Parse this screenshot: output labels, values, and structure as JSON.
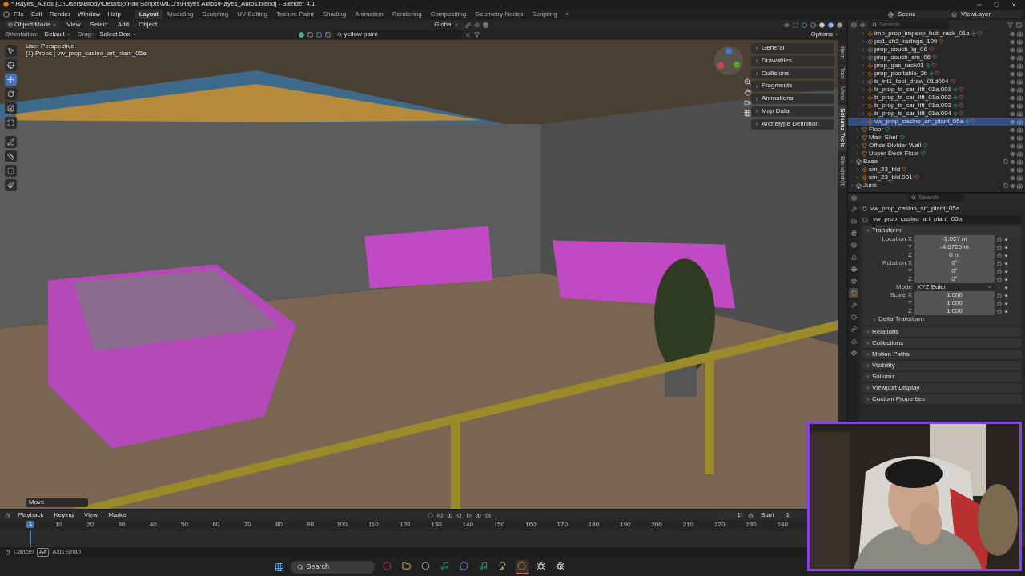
{
  "window": {
    "title": "* Hayes_Autos [C:\\Users\\Brody\\Desktop\\Fax Scripts\\MLO's\\Hayes Autos\\Hayes_Autos.blend] - Blender 4.1"
  },
  "menu": [
    "File",
    "Edit",
    "Render",
    "Window",
    "Help"
  ],
  "workspaces": [
    {
      "label": "Layout",
      "selected": true
    },
    {
      "label": "Modeling",
      "selected": false
    },
    {
      "label": "Sculpting",
      "selected": false
    },
    {
      "label": "UV Editing",
      "selected": false
    },
    {
      "label": "Texture Paint",
      "selected": false
    },
    {
      "label": "Shading",
      "selected": false
    },
    {
      "label": "Animation",
      "selected": false
    },
    {
      "label": "Rendering",
      "selected": false
    },
    {
      "label": "Compositing",
      "selected": false
    },
    {
      "label": "Geometry Nodes",
      "selected": false
    },
    {
      "label": "Scripting",
      "selected": false
    }
  ],
  "add_workspace": "+",
  "scene": "Scene",
  "view_layer": "ViewLayer",
  "viewport": {
    "mode": "Object Mode",
    "menus": [
      "View",
      "Select",
      "Add",
      "Object"
    ],
    "orientation_label": "Orientation:",
    "orientation": "Default",
    "drag_label": "Drag:",
    "drag": "Select Box",
    "transform": "Global",
    "search": "yellow paint",
    "options": "Options",
    "info": [
      "User Perspective",
      "(1) Props | vw_prop_casino_art_plant_05a"
    ],
    "last_operator": "Move",
    "tools": [
      {
        "kind": "select",
        "selected": false
      },
      {
        "kind": "cursor",
        "selected": false
      },
      {
        "kind": "move",
        "selected": true
      },
      {
        "kind": "rotate",
        "selected": false
      },
      {
        "kind": "scale",
        "selected": false
      },
      {
        "kind": "transform",
        "selected": false
      },
      {
        "kind": "annotate",
        "selected": false
      },
      {
        "kind": "measure",
        "selected": false
      },
      {
        "kind": "add",
        "selected": false
      },
      {
        "kind": "paint",
        "selected": false
      }
    ]
  },
  "n_panel": {
    "sections": [
      "General",
      "Drawables",
      "Collisions",
      "Fragments",
      "Animations",
      "Map Data",
      "Archetype Definition"
    ],
    "tabs": [
      {
        "label": "Item",
        "selected": false
      },
      {
        "label": "Tool",
        "selected": false
      },
      {
        "label": "View",
        "selected": false
      },
      {
        "label": "Sollumz Tools",
        "selected": true
      },
      {
        "label": "BlenderKit",
        "selected": false
      }
    ]
  },
  "outliner": {
    "search_placeholder": "Search",
    "tree": [
      {
        "children": [
          {
            "children": [
              {
                "name": "imp_prop_impexp_hub_rack_01a",
                "kind": "armature",
                "selected": false,
                "expanded": false
              },
              {
                "name": "po1_sh2_railings_109",
                "kind": "empty",
                "selected": false,
                "expanded": false
              },
              {
                "name": "prop_couch_lg_06",
                "kind": "empty",
                "selected": false,
                "expanded": false
              },
              {
                "name": "prop_couch_sm_06",
                "kind": "empty",
                "selected": false,
                "expanded": false
              },
              {
                "name": "prop_gas_rack01",
                "kind": "armature",
                "selected": false,
                "expanded": false
              },
              {
                "name": "prop_pooltable_3b",
                "kind": "armature",
                "selected": false,
                "expanded": false
              },
              {
                "name": "tr_int1_tool_draw_01d004",
                "kind": "empty",
                "selected": false,
                "expanded": false
              },
              {
                "name": "tr_prop_tr_car_lift_01a.001",
                "kind": "armature",
                "selected": false,
                "expanded": false
              },
              {
                "name": "tr_prop_tr_car_lift_01a.002",
                "kind": "armature",
                "selected": false,
                "expanded": false
              },
              {
                "name": "tr_prop_tr_car_lift_01a.003",
                "kind": "armature",
                "selected": false,
                "expanded": false
              },
              {
                "name": "tr_prop_tr_car_lift_01a.004",
                "kind": "armature",
                "selected": false,
                "expanded": false
              },
              {
                "name": "vw_prop_casino_art_plant_05a",
                "kind": "armature",
                "selected": true,
                "expanded": false
              }
            ]
          },
          {
            "name": "Floor",
            "kind": "mesh",
            "selected": false,
            "expanded": false
          },
          {
            "name": "Main Shell",
            "kind": "mesh",
            "selected": false,
            "expanded": false
          },
          {
            "name": "Office Divider Wall",
            "kind": "mesh",
            "selected": false,
            "expanded": false
          },
          {
            "name": "Upper Deck Floor",
            "kind": "mesh",
            "selected": false,
            "expanded": false
          }
        ]
      },
      {
        "name": "Base",
        "kind": "collection",
        "selected": false,
        "expanded": true,
        "children": [
          {
            "name": "sm_23_bld",
            "kind": "empty",
            "selected": false,
            "expanded": false
          },
          {
            "name": "sm_23_bld.001",
            "kind": "empty",
            "selected": false,
            "expanded": false
          }
        ]
      },
      {
        "name": "Junk",
        "kind": "collection",
        "selected": false,
        "expanded": false
      }
    ]
  },
  "properties": {
    "search_placeholder": "Search",
    "object": "vw_prop_casino_art_plant_05a",
    "name_field": "vw_prop_casino_art_plant_05a",
    "tabs": [
      {
        "kind": "tool",
        "selected": false
      },
      {
        "kind": "render",
        "selected": false
      },
      {
        "kind": "output",
        "selected": false
      },
      {
        "kind": "view_layer",
        "selected": false
      },
      {
        "kind": "scene",
        "selected": false
      },
      {
        "kind": "world",
        "selected": false
      },
      {
        "kind": "collection",
        "selected": false
      },
      {
        "kind": "object",
        "selected": true
      },
      {
        "kind": "modifiers",
        "selected": false
      },
      {
        "kind": "physics",
        "selected": false
      },
      {
        "kind": "constraints",
        "selected": false
      },
      {
        "kind": "data",
        "selected": false
      },
      {
        "kind": "texture",
        "selected": false
      }
    ],
    "transform": {
      "label": "Transform",
      "expanded": true,
      "rows": [
        {
          "label": "Location X",
          "value": "-1.027 m",
          "kind": "number"
        },
        {
          "label": "Y",
          "value": "-4.6725 m",
          "kind": "number"
        },
        {
          "label": "Z",
          "value": "0 m",
          "kind": "number"
        },
        {
          "label": "Rotation X",
          "value": "0°",
          "kind": "number"
        },
        {
          "label": "Y",
          "value": "0°",
          "kind": "number"
        },
        {
          "label": "Z",
          "value": "0°",
          "kind": "number"
        },
        {
          "label": "Mode",
          "value": "XYZ Euler",
          "kind": "dropdown"
        },
        {
          "label": "Scale X",
          "value": "1.000",
          "kind": "number"
        },
        {
          "label": "Y",
          "value": "1.000",
          "kind": "number"
        },
        {
          "label": "Z",
          "value": "1.000",
          "kind": "number"
        }
      ],
      "subsection": "Delta Transform"
    },
    "sections": [
      "Relations",
      "Collections",
      "Motion Paths",
      "Visibility",
      "Sollumz",
      "Viewport Display",
      "Custom Properties"
    ]
  },
  "timeline": {
    "menus": [
      "Playback",
      "Keying",
      "View",
      "Marker"
    ],
    "frame_field": "1",
    "start_label": "Start",
    "start": "1",
    "current_frame": "1",
    "ticks": [
      "10",
      "20",
      "30",
      "40",
      "50",
      "60",
      "70",
      "80",
      "90",
      "100",
      "110",
      "120",
      "130",
      "140",
      "150",
      "160",
      "170",
      "180",
      "190",
      "200",
      "210",
      "220",
      "230",
      "240"
    ]
  },
  "status": {
    "cancel": "Cancel",
    "key": "Alt",
    "action": "Axis Snap"
  },
  "taskbar": {
    "search_placeholder": "Search",
    "apps": [
      {
        "kind": "ring",
        "active": false
      },
      {
        "kind": "folder",
        "active": false
      },
      {
        "kind": "hexagon",
        "active": false
      },
      {
        "kind": "music",
        "active": false
      },
      {
        "kind": "chat",
        "active": false
      },
      {
        "kind": "music",
        "active": false
      },
      {
        "kind": "lamp",
        "active": false
      },
      {
        "kind": "blender",
        "active": true
      },
      {
        "kind": "creature",
        "active": false
      },
      {
        "kind": "creature",
        "active": false
      }
    ]
  }
}
